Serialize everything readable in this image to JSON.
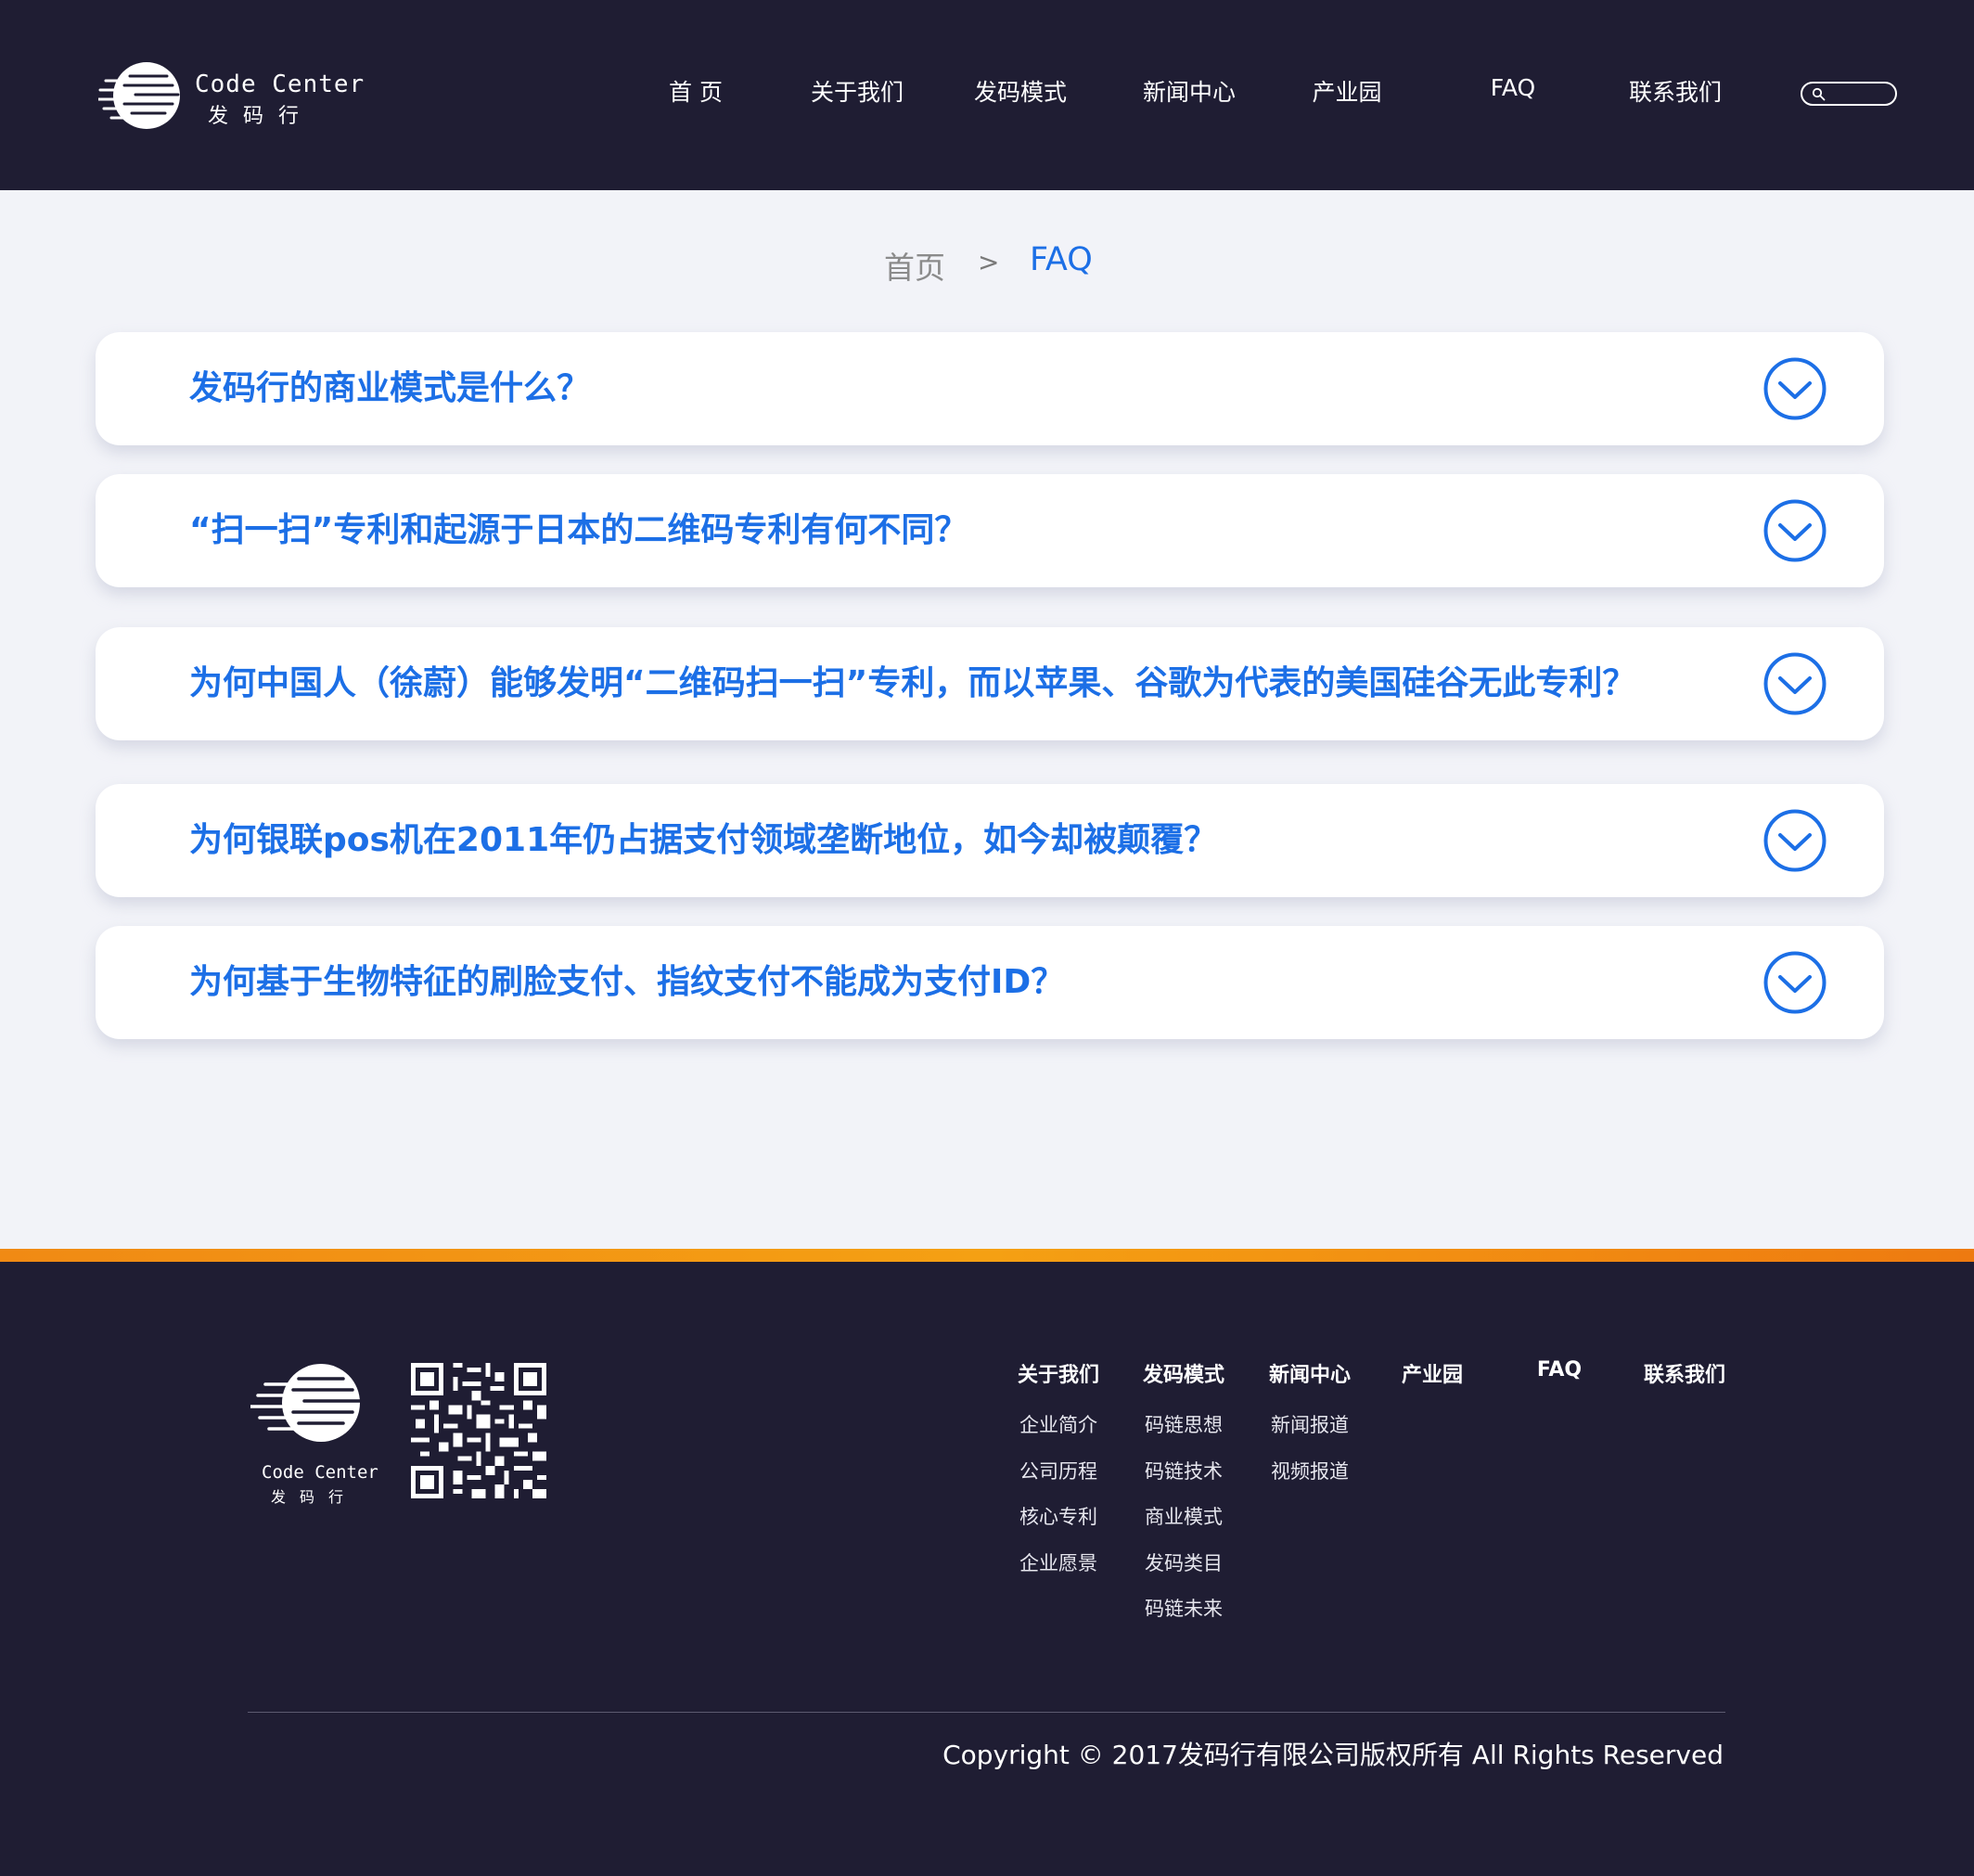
{
  "header": {
    "logo_en": "Code Center",
    "logo_cn": "发码行",
    "nav": [
      "首 页",
      "关于我们",
      "发码模式",
      "新闻中心",
      "产业园",
      "FAQ",
      "联系我们"
    ]
  },
  "breadcrumb": {
    "home": "首页",
    "separator": ">",
    "current": "FAQ"
  },
  "faq": [
    {
      "question": "发码行的商业模式是什么？",
      "expanded": false
    },
    {
      "question": "“扫一扫”专利和起源于日本的二维码专利有何不同？",
      "expanded": false
    },
    {
      "question": "为何中国人（徐蔚）能够发明“二维码扫一扫”专利，而以苹果、谷歌为代表的美国硅谷无此专利？",
      "expanded": false
    },
    {
      "question": "为何银联pos机在2011年仍占据支付领域垄断地位，如今却被颠覆？",
      "expanded": false
    },
    {
      "question": "为何基于生物特征的刷脸支付、指纹支付不能成为支付ID？",
      "expanded": false
    }
  ],
  "footer": {
    "logo_en": "Code Center",
    "logo_cn": "发码行",
    "columns": [
      {
        "title": "关于我们",
        "links": [
          "企业简介",
          "公司历程",
          "核心专利",
          "企业愿景"
        ]
      },
      {
        "title": "发码模式",
        "links": [
          "码链思想",
          "码链技术",
          "商业模式",
          "发码类目",
          "码链未来"
        ]
      },
      {
        "title": "新闻中心",
        "links": [
          "新闻报道",
          "视频报道"
        ]
      },
      {
        "title": "产业园",
        "links": []
      },
      {
        "title": "FAQ",
        "links": []
      },
      {
        "title": "联系我们",
        "links": []
      }
    ],
    "copyright": "Copyright  ©  2017发码行有限公司版权所有 All Rights Reserved"
  },
  "colors": {
    "dark_bg": "#1f1d33",
    "accent_blue": "#1c6fe6",
    "page_bg": "#f2f3f8",
    "orange_bar": "#f5a013"
  },
  "icons": [
    "search-icon",
    "chevron-down-circle-icon",
    "qr-code-icon"
  ]
}
